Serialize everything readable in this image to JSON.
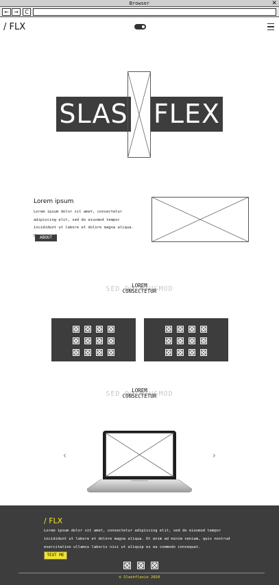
{
  "browser": {
    "title": "Browser",
    "back": "←",
    "forward": "→",
    "reload": "C",
    "close": "✕",
    "url": ""
  },
  "header": {
    "logo": "/ FLX",
    "menu_icon": "hamburger-icon",
    "theme_toggle_icon": "toggle-icon"
  },
  "hero": {
    "left_word": "SLAS",
    "right_word": "FLEX"
  },
  "about": {
    "title": "Lorem ipsum",
    "text": "Lorem ipsum dolor sit amet, consectetur adipiscing elit, sed do eiusmod tempor incididunt ut labore et dolore magna aliqua. Ut enim ad",
    "button": "ABOUT"
  },
  "section1": {
    "background_text": "SED DO EIUSMOD",
    "title_line1": "LOREM",
    "title_line2": "CONSECTETUR"
  },
  "section2": {
    "background_text": "SED DO EIUSMOD",
    "title_line1": "LOREM",
    "title_line2": "CONSECTETUR"
  },
  "carousel": {
    "prev_icon": "chevron-left-icon",
    "next_icon": "chevron-right-icon",
    "prev": "‹",
    "next": "›"
  },
  "footer": {
    "logo": "/ FLX",
    "text": "Lorem ipsum dolor sit amet, consectetur adipiscing elit, sed do eiusmod tempor incididunt ut labore et dolore magna aliqua. Ut enim ad minim veniam, quis nostrud exercitation ullamco laboris nisi ut aliquip ex ea commodo consequat.",
    "button": "TEXT ME",
    "copyright": "© Slashflexio 2020"
  },
  "colors": {
    "dark": "#3d3d3d",
    "accent": "#f2e52a"
  }
}
